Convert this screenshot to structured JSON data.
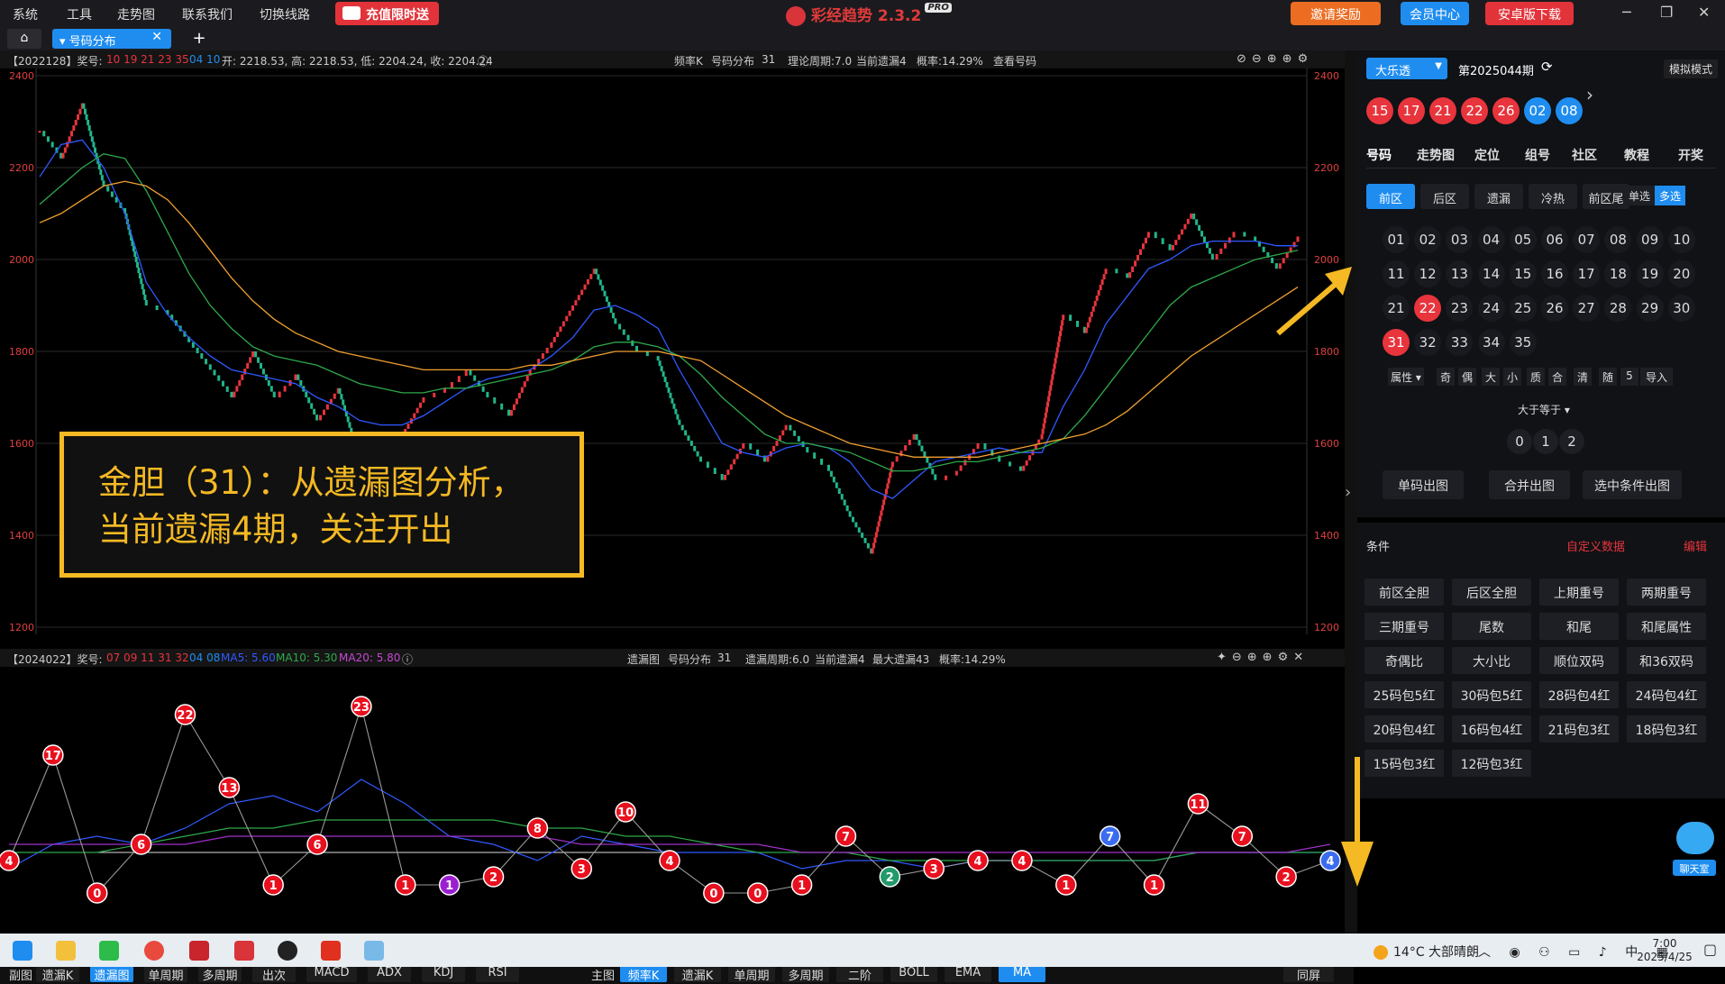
{
  "menubar": {
    "items": [
      "系统",
      "工具",
      "走势图",
      "联系我们",
      "切换线路"
    ],
    "recharge": "充值限时送",
    "app_title": "彩经趋势",
    "version": "2.3.2",
    "pro": "PRO",
    "invite": "邀请奖励",
    "member": "会员中心",
    "android": "安卓版下载"
  },
  "tabs": {
    "active": "号码分布"
  },
  "pane1": {
    "issue": "【2022128】奖号:",
    "nums_red": "10 19 21 23 35",
    "nums_blue": "04 10",
    "ohlc": "开: 2218.53, 高: 2218.53, 低: 2204.24, 收: 2204.24",
    "info1": "频率K",
    "info2": "号码分布",
    "info3": "31",
    "info4": "理论周期:7.0",
    "info5": "当前遗漏4",
    "info6": "概率:14.29%",
    "info7": "查看号码"
  },
  "pane2": {
    "issue": "【2024022】奖号:",
    "nums_red": "07 09 11 31 32",
    "nums_blue": "04 08",
    "ma5": "MA5: 5.60",
    "ma10": "MA10: 5.30",
    "ma20": "MA20: 5.80",
    "info1": "遗漏图",
    "info2": "号码分布",
    "info3": "31",
    "info4": "遗漏周期:6.0",
    "info5": "当前遗漏4",
    "info6": "最大遗漏43",
    "info7": "概率:14.29%"
  },
  "annotation": {
    "line1": "金胆（31）：从遗漏图分析，",
    "line2": "当前遗漏4期，关注开出"
  },
  "y_ticks": [
    "2400",
    "2200",
    "2000",
    "1800",
    "1600",
    "1400",
    "1200"
  ],
  "bottom_toolbar": {
    "sub_label": "副图",
    "sub": [
      "遗漏K",
      "遗漏图",
      "单周期",
      "多周期",
      "出次",
      "MACD",
      "ADX",
      "KDJ",
      "RSI"
    ],
    "sub_selected": "遗漏图",
    "main_label": "主图",
    "main": [
      "频率K",
      "遗漏K",
      "单周期",
      "多周期",
      "二阶",
      "BOLL",
      "EMA",
      "MA"
    ],
    "main_selected": [
      "频率K",
      "MA"
    ],
    "same_screen": "同屏"
  },
  "right_panel": {
    "lottery": "大乐透",
    "issue": "第2025044期",
    "sim_mode": "模拟模式",
    "draw_red": [
      "15",
      "17",
      "21",
      "22",
      "26"
    ],
    "draw_blue": [
      "02",
      "08"
    ],
    "nav_tabs": [
      "号码",
      "走势图",
      "定位",
      "组号",
      "社区",
      "教程",
      "开奖"
    ],
    "sub_tabs": [
      "前区",
      "后区",
      "遗漏",
      "冷热",
      "前区尾"
    ],
    "single": "单选",
    "multi": "多选",
    "numbers": [
      "01",
      "02",
      "03",
      "04",
      "05",
      "06",
      "07",
      "08",
      "09",
      "10",
      "11",
      "12",
      "13",
      "14",
      "15",
      "16",
      "17",
      "18",
      "19",
      "20",
      "21",
      "22",
      "23",
      "24",
      "25",
      "26",
      "27",
      "28",
      "29",
      "30",
      "31",
      "32",
      "33",
      "34",
      "35"
    ],
    "selected_numbers": [
      "22",
      "31"
    ],
    "attrs": [
      "属性",
      "奇",
      "偶",
      "大",
      "小",
      "质",
      "合",
      "清",
      "随",
      "5",
      "导入"
    ],
    "ge_select": "大于等于",
    "zero_one_two": [
      "0",
      "1",
      "2"
    ],
    "actions": [
      "单码出图",
      "合并出图",
      "选中条件出图"
    ],
    "cond_label": "条件",
    "custom_data": "自定义数据",
    "edit": "编辑",
    "conditions": [
      "前区全胆",
      "后区全胆",
      "上期重号",
      "两期重号",
      "三期重号",
      "尾数",
      "和尾",
      "和尾属性",
      "奇偶比",
      "大小比",
      "顺位双码",
      "和36双码",
      "25码包5红",
      "30码包5红",
      "28码包4红",
      "24码包4红",
      "20码包4红",
      "16码包4红",
      "21码包3红",
      "18码包3红",
      "15码包3红",
      "12码包3红"
    ],
    "chat": "聊天室"
  },
  "taskbar": {
    "weather": "14°C 大部晴朗",
    "ime": "中",
    "time": "7:00",
    "date": "2025/4/25"
  },
  "colors": {
    "accent": "#1f8df0",
    "red": "#e8343c",
    "annotation": "#f4b923",
    "up": "#e8343c",
    "down": "#21b58a",
    "ma5": "#2f59ff",
    "ma10": "#2ea84a",
    "ma20": "#f0a030"
  },
  "chart_data": [
    {
      "type": "candlestick-line",
      "title": "号码分布 31 频率K",
      "ylim": [
        1200,
        2400
      ],
      "y_ticks": [
        2400,
        2200,
        2000,
        1800,
        1600,
        1400,
        1200
      ],
      "close": [
        2280,
        2220,
        2340,
        2160,
        2100,
        1900,
        1880,
        1820,
        1760,
        1700,
        1800,
        1700,
        1750,
        1650,
        1720,
        1560,
        1600,
        1620,
        1700,
        1720,
        1760,
        1700,
        1660,
        1760,
        1820,
        1900,
        1980,
        1860,
        1800,
        1780,
        1640,
        1560,
        1520,
        1600,
        1560,
        1640,
        1580,
        1540,
        1440,
        1360,
        1560,
        1620,
        1520,
        1540,
        1600,
        1560,
        1540,
        1620,
        1880,
        1840,
        1980,
        1960,
        2060,
        2020,
        2100,
        2000,
        2060,
        2040,
        1980,
        2050
      ],
      "series": [
        {
          "name": "MA5",
          "color": "#2f59ff",
          "values": [
            2180,
            2250,
            2260,
            2200,
            2100,
            1950,
            1880,
            1830,
            1790,
            1760,
            1750,
            1740,
            1730,
            1700,
            1680,
            1650,
            1640,
            1640,
            1660,
            1690,
            1720,
            1740,
            1750,
            1760,
            1790,
            1830,
            1890,
            1900,
            1880,
            1850,
            1760,
            1680,
            1600,
            1580,
            1570,
            1590,
            1600,
            1590,
            1560,
            1500,
            1480,
            1520,
            1560,
            1570,
            1580,
            1590,
            1580,
            1580,
            1680,
            1760,
            1860,
            1920,
            1980,
            2000,
            2030,
            2040,
            2040,
            2040,
            2030,
            2030
          ]
        },
        {
          "name": "MA10",
          "color": "#2ea84a",
          "values": [
            2120,
            2160,
            2200,
            2230,
            2220,
            2150,
            2060,
            1970,
            1900,
            1850,
            1810,
            1790,
            1780,
            1770,
            1750,
            1730,
            1720,
            1710,
            1710,
            1720,
            1720,
            1730,
            1740,
            1750,
            1760,
            1780,
            1810,
            1820,
            1820,
            1810,
            1790,
            1750,
            1700,
            1660,
            1620,
            1600,
            1600,
            1590,
            1580,
            1560,
            1540,
            1540,
            1550,
            1560,
            1560,
            1570,
            1580,
            1590,
            1610,
            1660,
            1720,
            1780,
            1840,
            1900,
            1940,
            1960,
            1980,
            2000,
            2010,
            2020
          ]
        },
        {
          "name": "MA20",
          "color": "#f0a030",
          "values": [
            2080,
            2100,
            2130,
            2160,
            2170,
            2160,
            2130,
            2080,
            2020,
            1960,
            1910,
            1870,
            1840,
            1820,
            1800,
            1790,
            1780,
            1770,
            1760,
            1760,
            1760,
            1760,
            1760,
            1770,
            1770,
            1780,
            1790,
            1800,
            1800,
            1800,
            1790,
            1780,
            1750,
            1720,
            1690,
            1660,
            1640,
            1620,
            1600,
            1590,
            1580,
            1570,
            1570,
            1570,
            1570,
            1580,
            1590,
            1600,
            1610,
            1620,
            1640,
            1670,
            1710,
            1750,
            1790,
            1820,
            1850,
            1880,
            1910,
            1940
          ]
        }
      ]
    },
    {
      "type": "line",
      "title": "遗漏图",
      "points": [
        4,
        17,
        0,
        6,
        22,
        13,
        1,
        6,
        23,
        1,
        1,
        2,
        8,
        3,
        10,
        4,
        0,
        0,
        1,
        7,
        2,
        3,
        4,
        4,
        1,
        7,
        1,
        11,
        7,
        2,
        4
      ],
      "point_colors": [
        "red",
        "red",
        "red",
        "red",
        "red",
        "red",
        "red",
        "red",
        "red",
        "red",
        "purple",
        "red",
        "red",
        "red",
        "red",
        "red",
        "red",
        "red",
        "red",
        "red",
        "green",
        "red",
        "red",
        "red",
        "red",
        "blue",
        "red",
        "red",
        "red",
        "red",
        "blue"
      ],
      "series": [
        {
          "name": "MA5",
          "color": "#2f59ff",
          "values": [
            3,
            6,
            7,
            6,
            8,
            11,
            12,
            10,
            14,
            11,
            7,
            6,
            4,
            7,
            6,
            5,
            5,
            5,
            3,
            4,
            4,
            3,
            4,
            4,
            4,
            4,
            4,
            5,
            5,
            5,
            5
          ]
        },
        {
          "name": "MA10",
          "color": "#2ea84a",
          "values": [
            5,
            5,
            5,
            6,
            7,
            8,
            8,
            9,
            9,
            9,
            9,
            9,
            8,
            8,
            7,
            7,
            6,
            5,
            5,
            5,
            4,
            4,
            4,
            4,
            4,
            4,
            4,
            5,
            5,
            5,
            5
          ]
        },
        {
          "name": "MA20",
          "color": "#a030c8",
          "values": [
            6,
            6,
            6,
            6,
            6,
            7,
            7,
            7,
            7,
            7,
            7,
            7,
            7,
            6,
            6,
            6,
            6,
            6,
            5,
            5,
            5,
            5,
            5,
            5,
            5,
            5,
            5,
            5,
            5,
            5,
            6
          ]
        }
      ]
    }
  ]
}
